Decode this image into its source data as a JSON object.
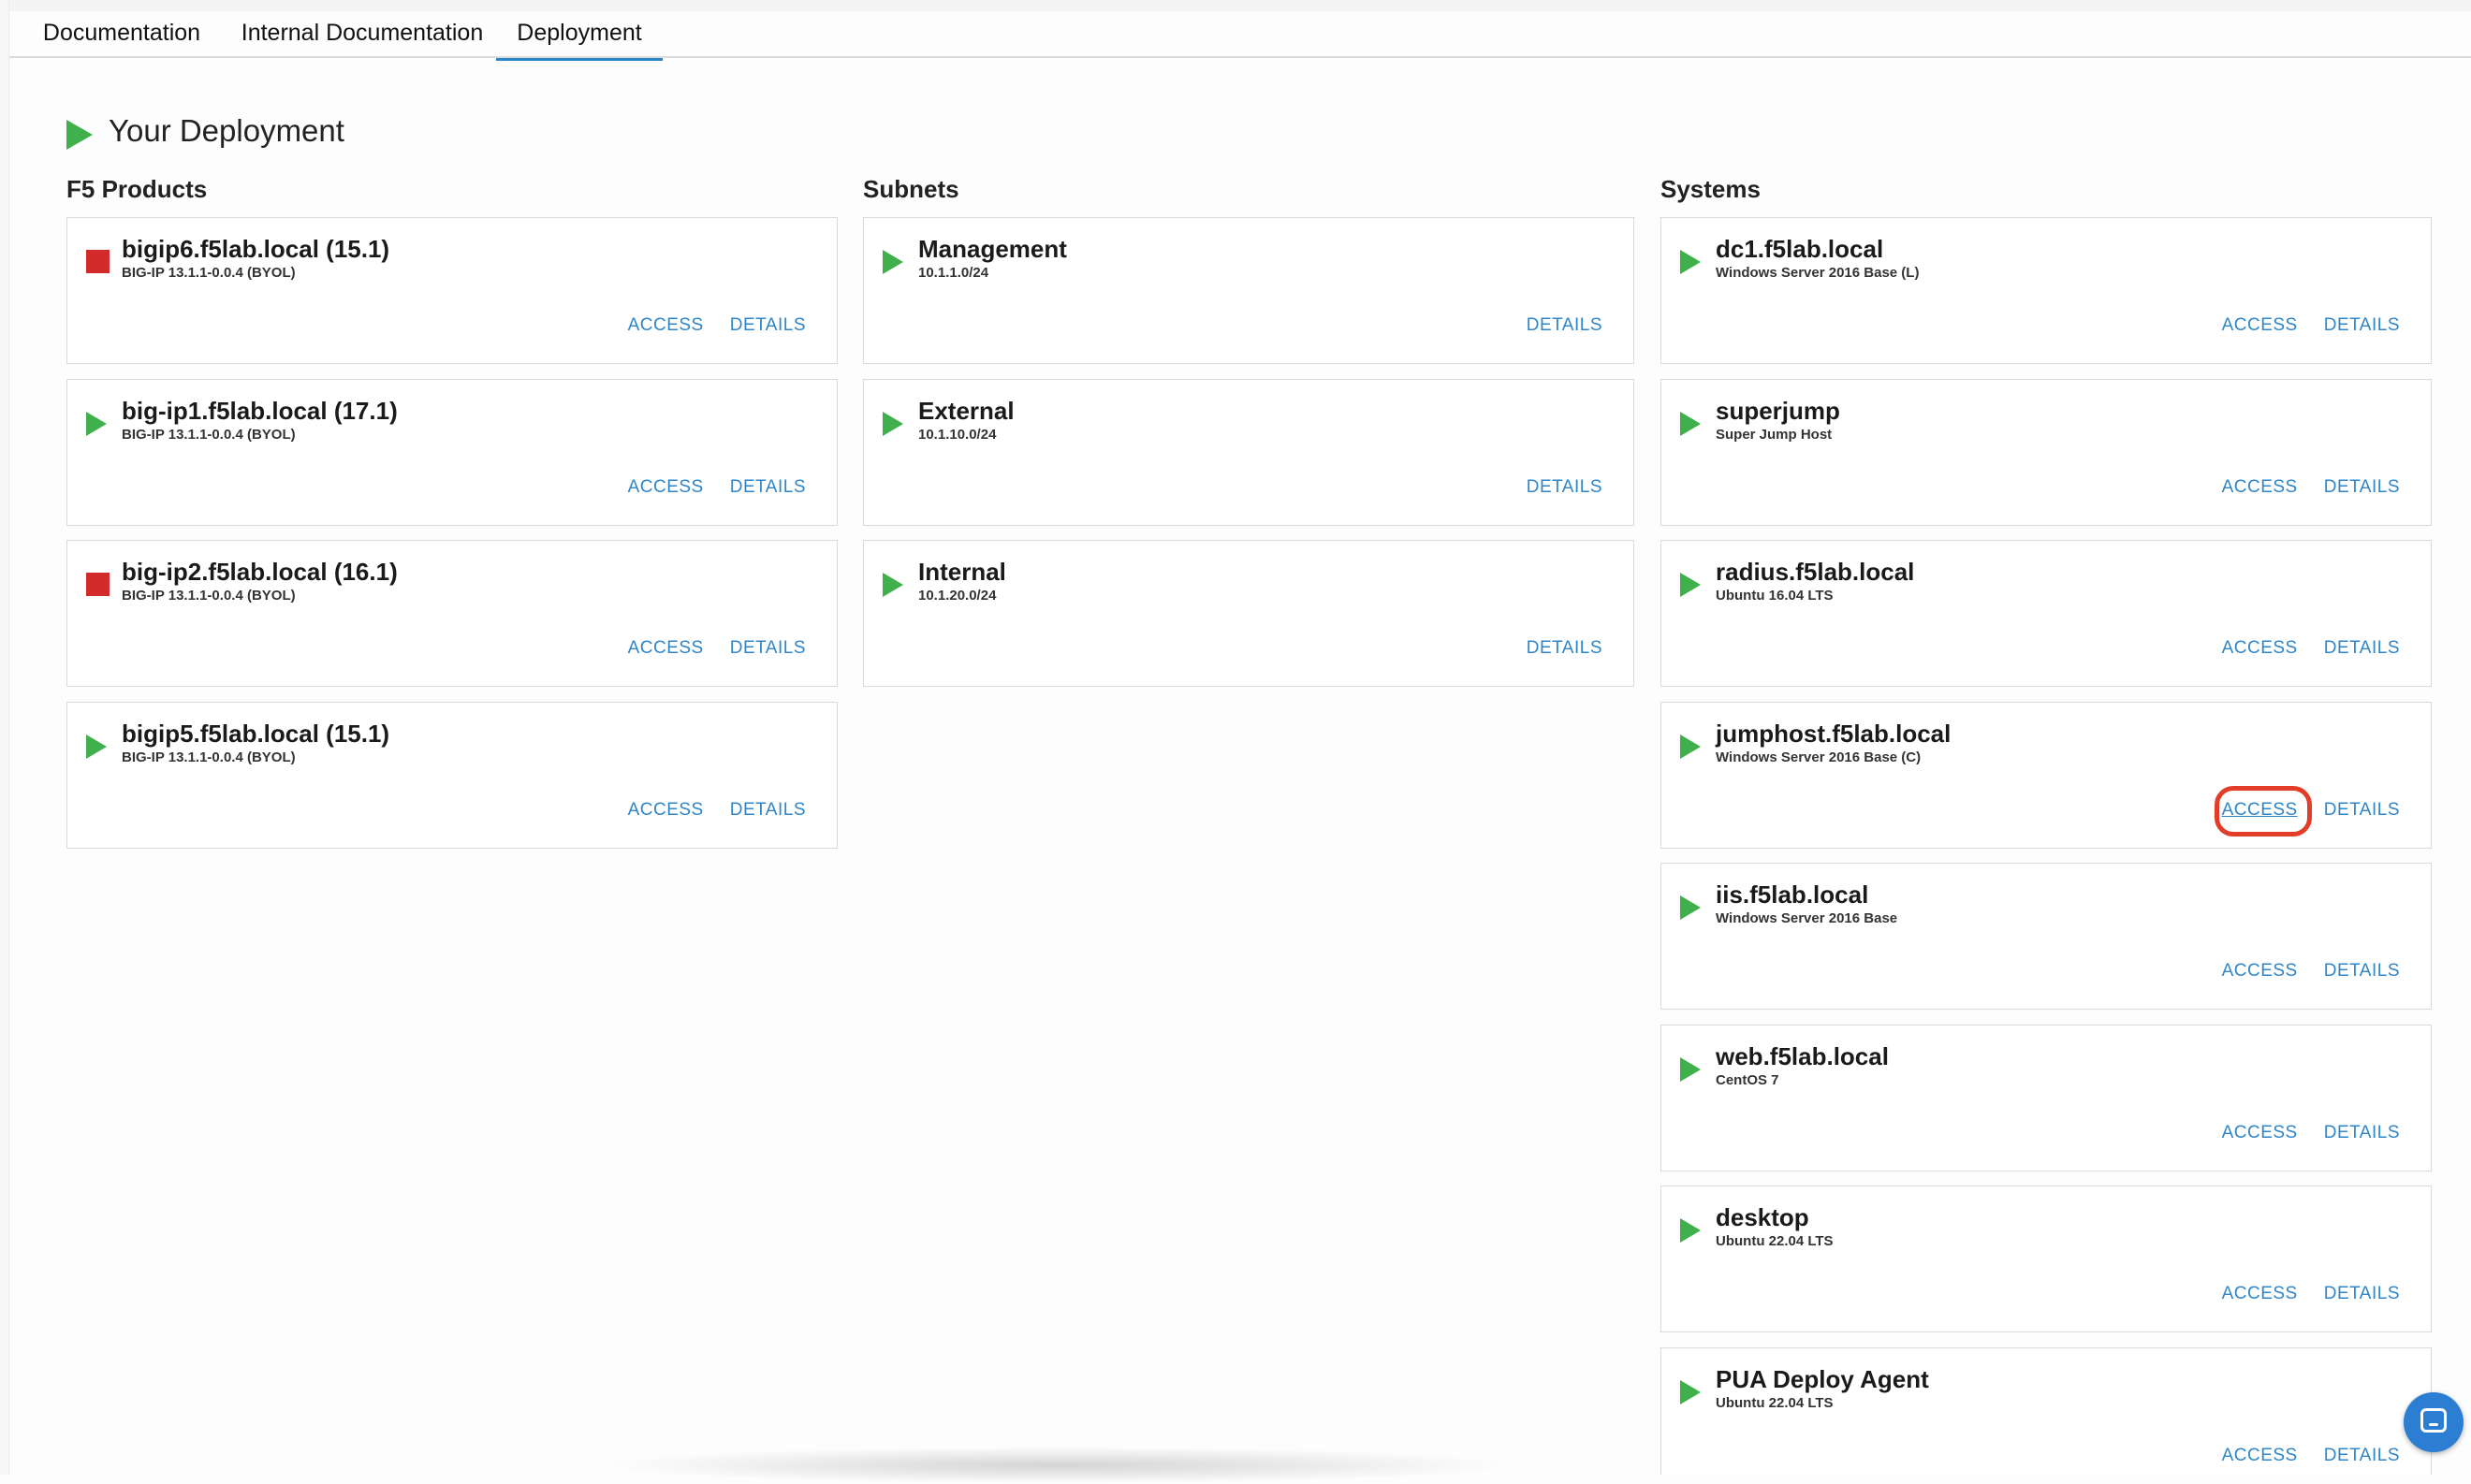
{
  "tabs": [
    {
      "label": "Documentation"
    },
    {
      "label": "Internal Documentation"
    },
    {
      "label": "Deployment",
      "active": true
    }
  ],
  "page": {
    "title": "Your Deployment"
  },
  "columns": {
    "products": {
      "heading": "F5 Products",
      "cards": [
        {
          "name": "bigip6.f5lab.local (15.1)",
          "sub": "BIG-IP 13.1.1-0.0.4 (BYOL)",
          "status": "stopped",
          "access": "ACCESS",
          "details": "DETAILS"
        },
        {
          "name": "big-ip1.f5lab.local (17.1)",
          "sub": "BIG-IP 13.1.1-0.0.4 (BYOL)",
          "status": "running",
          "access": "ACCESS",
          "details": "DETAILS"
        },
        {
          "name": "big-ip2.f5lab.local (16.1)",
          "sub": "BIG-IP 13.1.1-0.0.4 (BYOL)",
          "status": "stopped",
          "access": "ACCESS",
          "details": "DETAILS"
        },
        {
          "name": "bigip5.f5lab.local (15.1)",
          "sub": "BIG-IP 13.1.1-0.0.4 (BYOL)",
          "status": "running",
          "access": "ACCESS",
          "details": "DETAILS"
        }
      ]
    },
    "subnets": {
      "heading": "Subnets",
      "cards": [
        {
          "name": "Management",
          "sub": "10.1.1.0/24",
          "status": "running",
          "details": "DETAILS"
        },
        {
          "name": "External",
          "sub": "10.1.10.0/24",
          "status": "running",
          "details": "DETAILS"
        },
        {
          "name": "Internal",
          "sub": "10.1.20.0/24",
          "status": "running",
          "details": "DETAILS"
        }
      ]
    },
    "systems": {
      "heading": "Systems",
      "cards": [
        {
          "name": "dc1.f5lab.local",
          "sub": "Windows Server 2016 Base (L)",
          "status": "running",
          "access": "ACCESS",
          "details": "DETAILS"
        },
        {
          "name": "superjump",
          "sub": "Super Jump Host",
          "status": "running",
          "access": "ACCESS",
          "details": "DETAILS"
        },
        {
          "name": "radius.f5lab.local",
          "sub": "Ubuntu 16.04 LTS",
          "status": "running",
          "access": "ACCESS",
          "details": "DETAILS"
        },
        {
          "name": "jumphost.f5lab.local",
          "sub": "Windows Server 2016 Base (C)",
          "status": "running",
          "access": "ACCESS",
          "details": "DETAILS"
        },
        {
          "name": "iis.f5lab.local",
          "sub": "Windows Server 2016 Base",
          "status": "running",
          "access": "ACCESS",
          "details": "DETAILS"
        },
        {
          "name": "web.f5lab.local",
          "sub": "CentOS 7",
          "status": "running",
          "access": "ACCESS",
          "details": "DETAILS"
        },
        {
          "name": "desktop",
          "sub": "Ubuntu 22.04 LTS",
          "status": "running",
          "access": "ACCESS",
          "details": "DETAILS"
        },
        {
          "name": "PUA Deploy Agent",
          "sub": "Ubuntu 22.04 LTS",
          "status": "running",
          "access": "ACCESS",
          "details": "DETAILS"
        }
      ]
    }
  },
  "colors": {
    "accent": "#2f86c9",
    "running": "#3fb04b",
    "stopped": "#d32b2b",
    "highlight": "#e23d28"
  },
  "icons": {
    "chat": "chat-bubble-icon"
  }
}
